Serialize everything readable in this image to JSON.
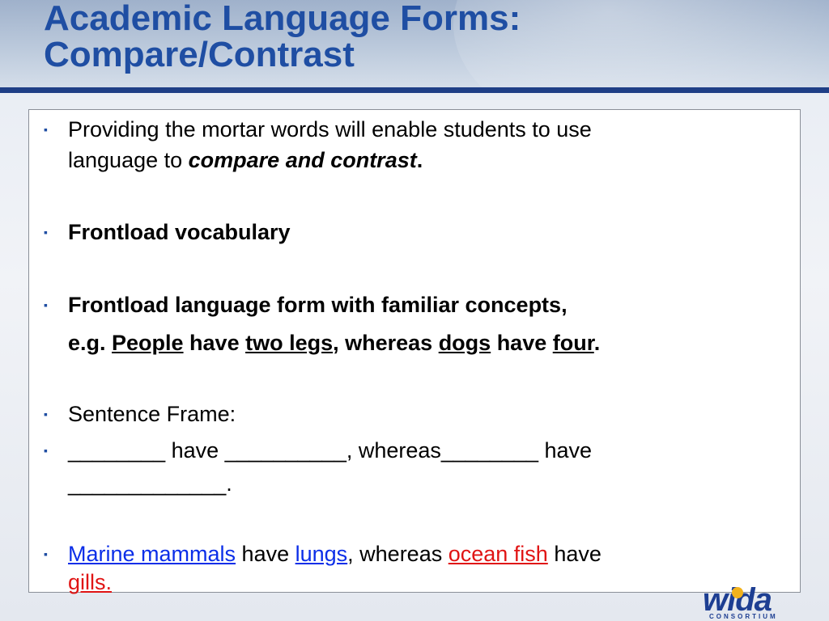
{
  "slide": {
    "title_line1": "Academic Language Forms:",
    "title_line2": "Compare/Contrast"
  },
  "bullets": {
    "b1_line1": "Providing the mortar words will enable students to use",
    "b1_line2_a": "language to ",
    "b1_line2_b": "compare and contrast",
    "b1_line2_c": ".",
    "b2": "Frontload vocabulary",
    "b3_line1": "Frontload language form with familiar concepts,",
    "b3_line2": {
      "a": "e.g. ",
      "b": "People",
      "c": " have ",
      "d": "two legs",
      "e": ", whereas ",
      "f": "dogs",
      "g": " have ",
      "h": "four",
      "i": "."
    },
    "b4": "Sentence Frame:",
    "b5_line1": "________ have __________, whereas________ have",
    "b5_line2": "_____________.",
    "b6_line1": {
      "a": "Marine mammals",
      "b": " have ",
      "c": "lungs",
      "d": ", whereas ",
      "e": "ocean fish",
      "f": " have"
    },
    "b6_line2": "gills."
  },
  "logo": {
    "word": "wida",
    "sub": "CONSORTIUM"
  },
  "colors": {
    "title": "#1f4ea3",
    "rule": "#1f3f86",
    "link_blue": "#0b2ee8",
    "link_red": "#e01414"
  }
}
